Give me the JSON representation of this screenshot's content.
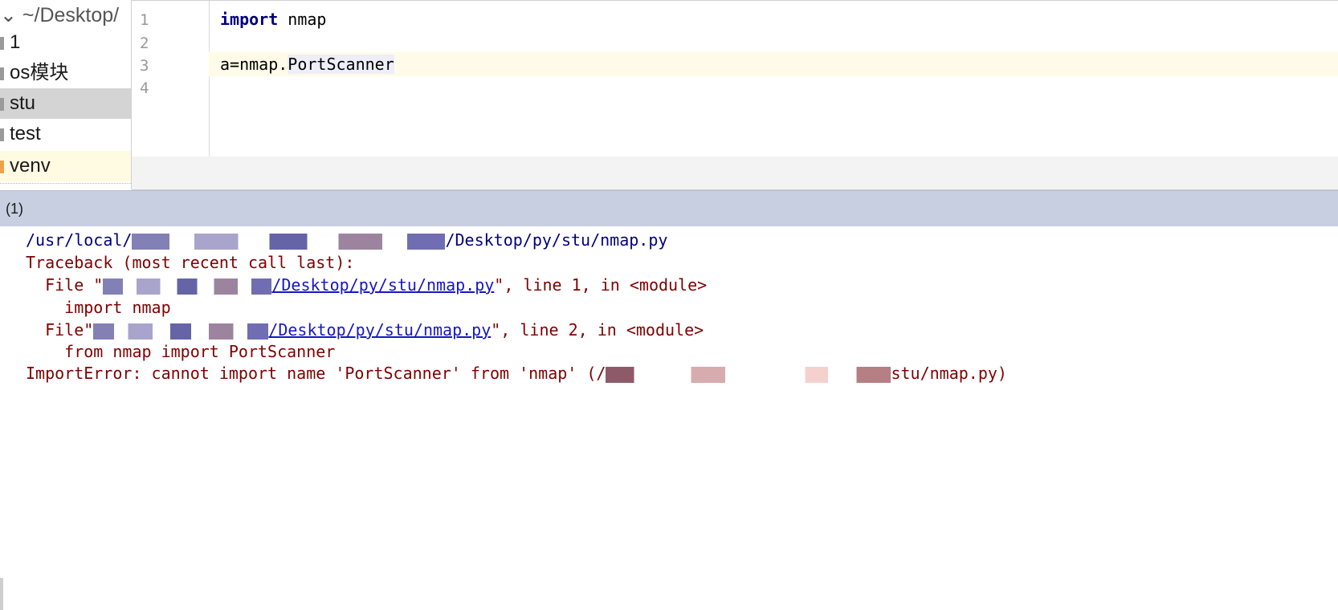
{
  "sidebar": {
    "root_label": "~/Desktop/",
    "items": [
      {
        "label": "1",
        "state": "normal"
      },
      {
        "label": "os模块",
        "state": "normal"
      },
      {
        "label": "stu",
        "state": "selected"
      },
      {
        "label": "test",
        "state": "normal"
      },
      {
        "label": "venv",
        "state": "excluded"
      }
    ]
  },
  "editor": {
    "lines": [
      {
        "number": "1",
        "keyword": "import",
        "rest": " nmap"
      },
      {
        "number": "2",
        "text": ""
      },
      {
        "number": "3",
        "prefix": "a=nmap.",
        "highlight": "PortScanner",
        "current": true
      },
      {
        "number": "4",
        "text": ""
      }
    ]
  },
  "run_panel": {
    "title": "(1)",
    "console": {
      "cmd_prefix": "/usr/local/",
      "cmd_suffix": "/Desktop/py/stu/nmap.py",
      "traceback_header": "Traceback (most recent call last):",
      "frame1": {
        "file_label": "  File \"",
        "path": "/Desktop/py/stu/nmap.py",
        "tail": "\", line 1, in <module>",
        "source": "    import nmap"
      },
      "frame2": {
        "file_label": "  File\"",
        "path": "/Desktop/py/stu/nmap.py",
        "tail": "\", line 2, in <module>",
        "source": "    from nmap import PortScanner"
      },
      "error_prefix": "ImportError: cannot import name 'PortScanner' from 'nmap' (/",
      "error_suffix": "stu/nmap.py)"
    }
  }
}
